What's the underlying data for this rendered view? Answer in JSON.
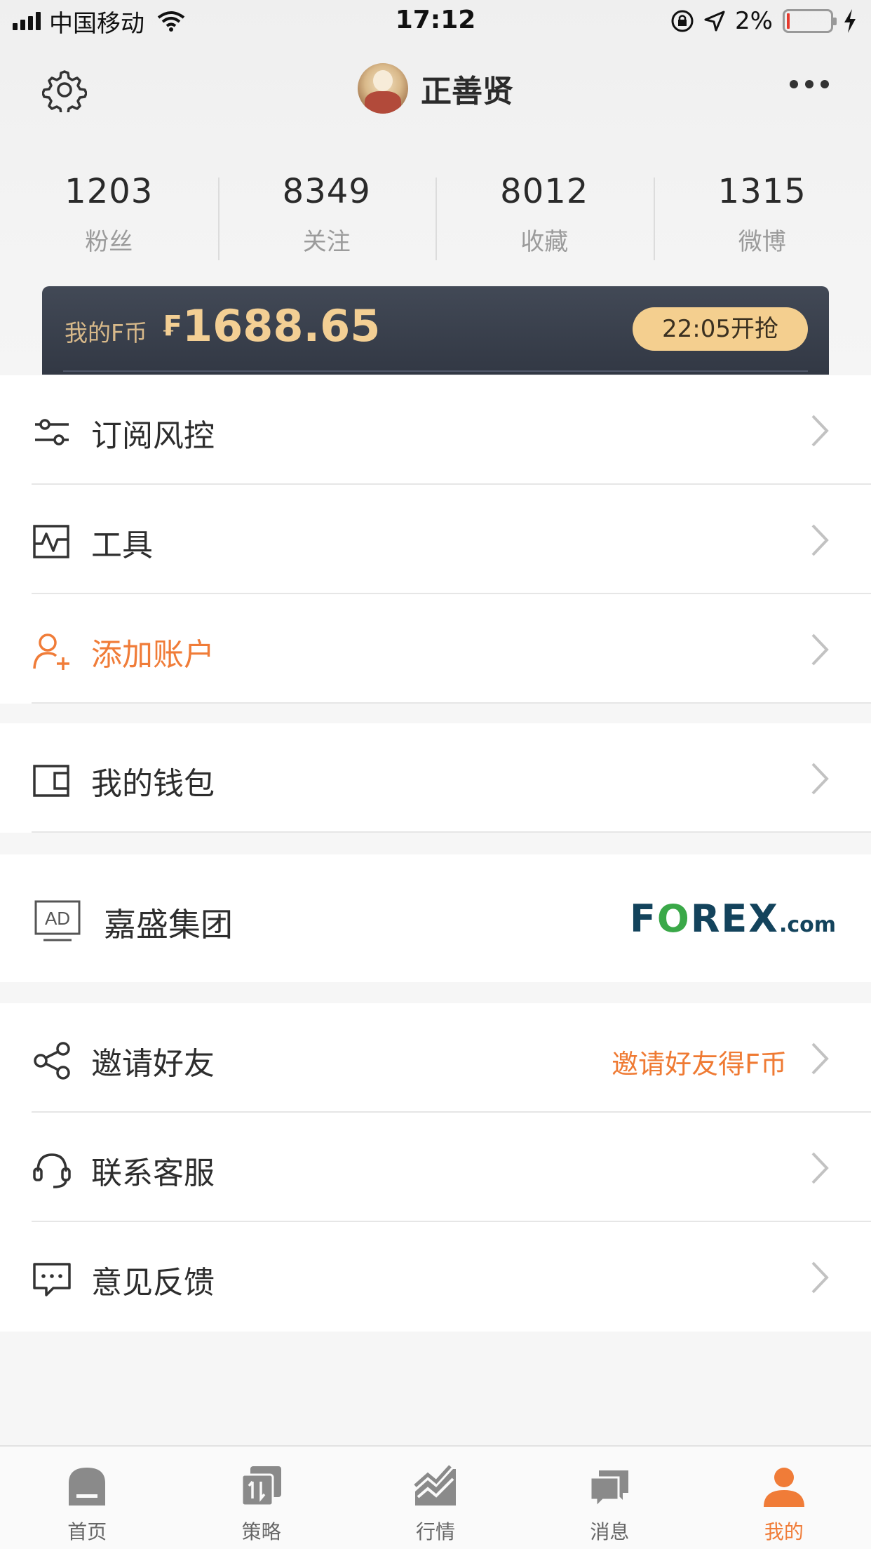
{
  "status_bar": {
    "carrier": "中国移动",
    "time": "17:12",
    "battery_percent": "2%"
  },
  "profile": {
    "name": "正善贤"
  },
  "stats": [
    {
      "value": "1203",
      "label": "粉丝"
    },
    {
      "value": "8349",
      "label": "关注"
    },
    {
      "value": "8012",
      "label": "收藏"
    },
    {
      "value": "1315",
      "label": "微博"
    }
  ],
  "coin_card": {
    "label": "我的F币",
    "symbol": "₣",
    "amount": "1688.65",
    "button_label": "22:05开抢"
  },
  "menu_group1": [
    {
      "label": "订阅风控",
      "icon": "sliders-icon"
    },
    {
      "label": "工具",
      "icon": "chart-tool-icon"
    },
    {
      "label": "添加账户",
      "icon": "add-user-icon",
      "highlight": true
    }
  ],
  "menu_group2": [
    {
      "label": "我的钱包",
      "icon": "wallet-icon"
    }
  ],
  "ad": {
    "label": "嘉盛集团",
    "badge": "AD",
    "brand_prefix": "F",
    "brand_o": "O",
    "brand_suffix": "REX",
    "brand_domain": ".com"
  },
  "menu_group3": [
    {
      "label": "邀请好友",
      "icon": "share-icon",
      "extra": "邀请好友得F币"
    },
    {
      "label": "联系客服",
      "icon": "headset-icon"
    },
    {
      "label": "意见反馈",
      "icon": "feedback-icon"
    }
  ],
  "tabs": [
    {
      "label": "首页",
      "icon": "home-icon"
    },
    {
      "label": "策略",
      "icon": "strategy-icon"
    },
    {
      "label": "行情",
      "icon": "market-icon"
    },
    {
      "label": "消息",
      "icon": "message-icon"
    },
    {
      "label": "我的",
      "icon": "profile-icon",
      "active": true
    }
  ],
  "colors": {
    "accent": "#f07c38",
    "coin_gold": "#f3cf94",
    "card_dark": "#3a404c"
  }
}
